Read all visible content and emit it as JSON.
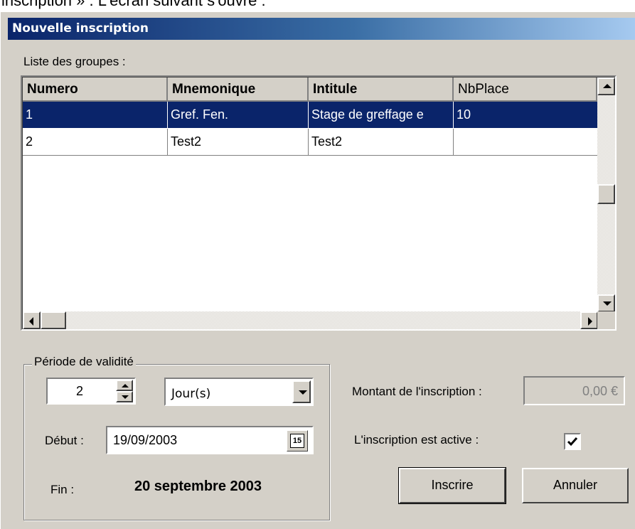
{
  "page_caption": "inscription » . L'écran suivant s'ouvre :",
  "window": {
    "title": "Nouvelle inscription"
  },
  "groups": {
    "label": "Liste des groupes :",
    "columns": [
      "Numero",
      "Mnemonique",
      "Intitule",
      "NbPlace"
    ],
    "rows": [
      {
        "numero": "1",
        "mnemonique": "Gref. Fen.",
        "intitule": "Stage de greffage e",
        "nbplace": "10",
        "selected": true
      },
      {
        "numero": "2",
        "mnemonique": "Test2",
        "intitule": "Test2",
        "nbplace": "",
        "selected": false
      }
    ]
  },
  "validity": {
    "legend": "Période de validité",
    "duration_value": "2",
    "duration_unit": "Jour(s)",
    "start_label": "Début :",
    "start_date": "19/09/2003",
    "calendar_icon_text": "15",
    "end_label": "Fin :",
    "end_date": "20 septembre 2003"
  },
  "amount": {
    "label": "Montant de l'inscription :",
    "value": "0,00 €"
  },
  "active": {
    "label": "L'inscription est active :",
    "checked": true
  },
  "buttons": {
    "register": "Inscrire",
    "cancel": "Annuler"
  },
  "colors": {
    "selection": "#0a246a",
    "face": "#d4d0c8",
    "title_start": "#0a246a",
    "title_end": "#a6caf0"
  }
}
